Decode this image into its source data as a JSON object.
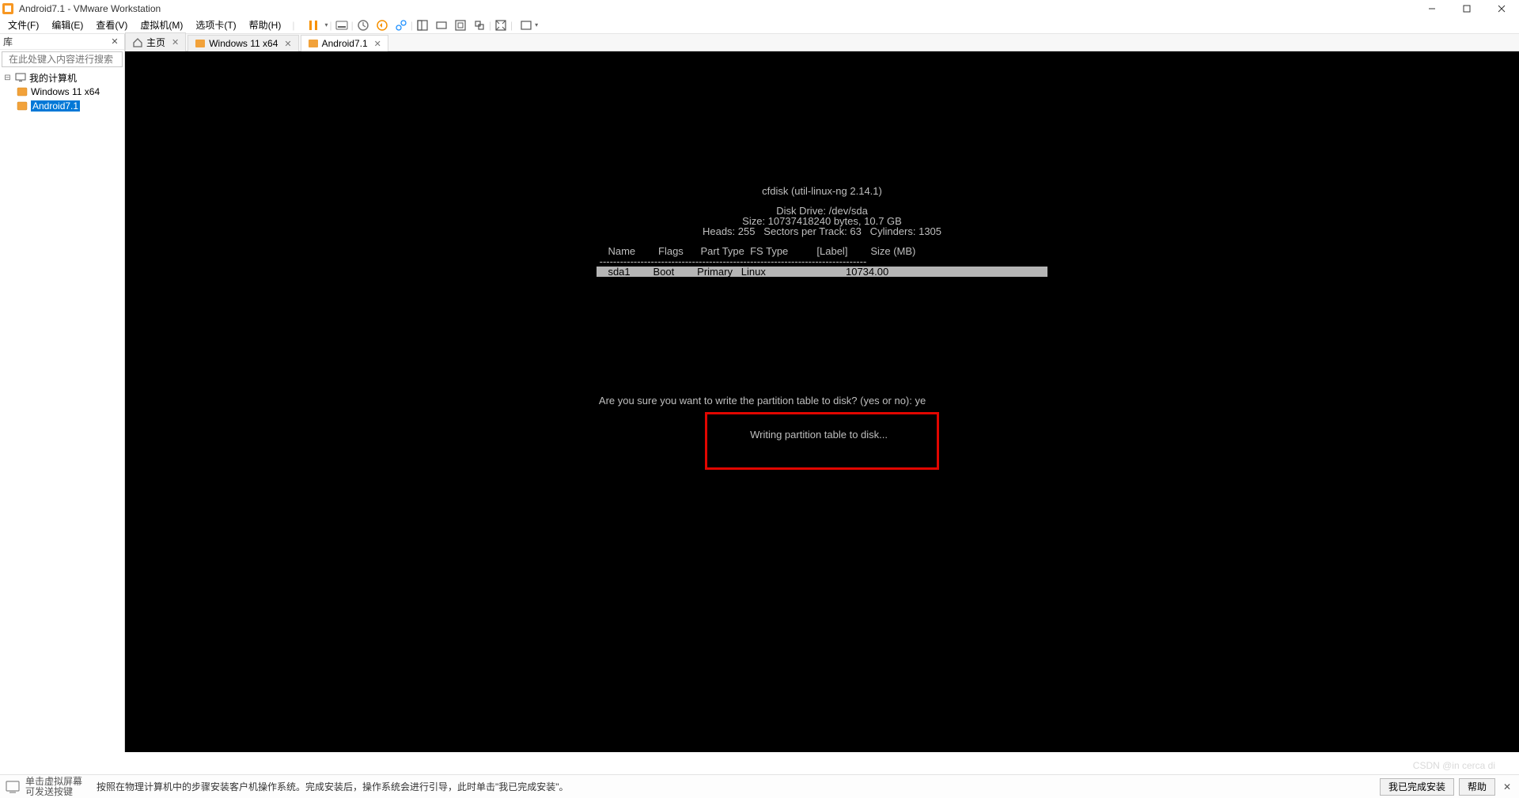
{
  "title": "Android7.1 - VMware Workstation",
  "menus": {
    "file": "文件(F)",
    "edit": "编辑(E)",
    "view": "查看(V)",
    "vm": "虚拟机(M)",
    "tabs": "选项卡(T)",
    "help": "帮助(H)"
  },
  "library": {
    "header": "库",
    "search_placeholder": "在此处键入内容进行搜索",
    "root": "我的计算机",
    "items": [
      {
        "label": "Windows 11 x64",
        "selected": false
      },
      {
        "label": "Android7.1",
        "selected": true
      }
    ]
  },
  "vmtabs": [
    {
      "label": "主页",
      "icon": "home",
      "active": false,
      "closable": true
    },
    {
      "label": "Windows 11 x64",
      "icon": "win",
      "active": false,
      "closable": true
    },
    {
      "label": "Android7.1",
      "icon": "vm",
      "active": true,
      "closable": true
    }
  ],
  "terminal": {
    "title": "cfdisk (util-linux-ng 2.14.1)",
    "drive": "Disk Drive: /dev/sda",
    "size": "Size: 10737418240 bytes, 10.7 GB",
    "geom": "Heads: 255   Sectors per Track: 63   Cylinders: 1305",
    "hdr": "    Name        Flags      Part Type  FS Type          [Label]        Size (MB)",
    "dash": " ------------------------------------------------------------------------------",
    "row": "    sda1        Boot        Primary   Linux                            10734.00",
    "prompt": " Are you sure you want to write the partition table to disk? (yes or no): ye",
    "status": "Writing partition table to disk..."
  },
  "installbar": {
    "hint": "单击虚拟屏幕\n可发送按键",
    "msg": "按照在物理计算机中的步骤安装客户机操作系统。完成安装后，操作系统会进行引导，此时单击\"我已完成安装\"。",
    "btn_done": "我已完成安装",
    "btn_help": "帮助"
  },
  "watermark": "CSDN @in cerca di"
}
